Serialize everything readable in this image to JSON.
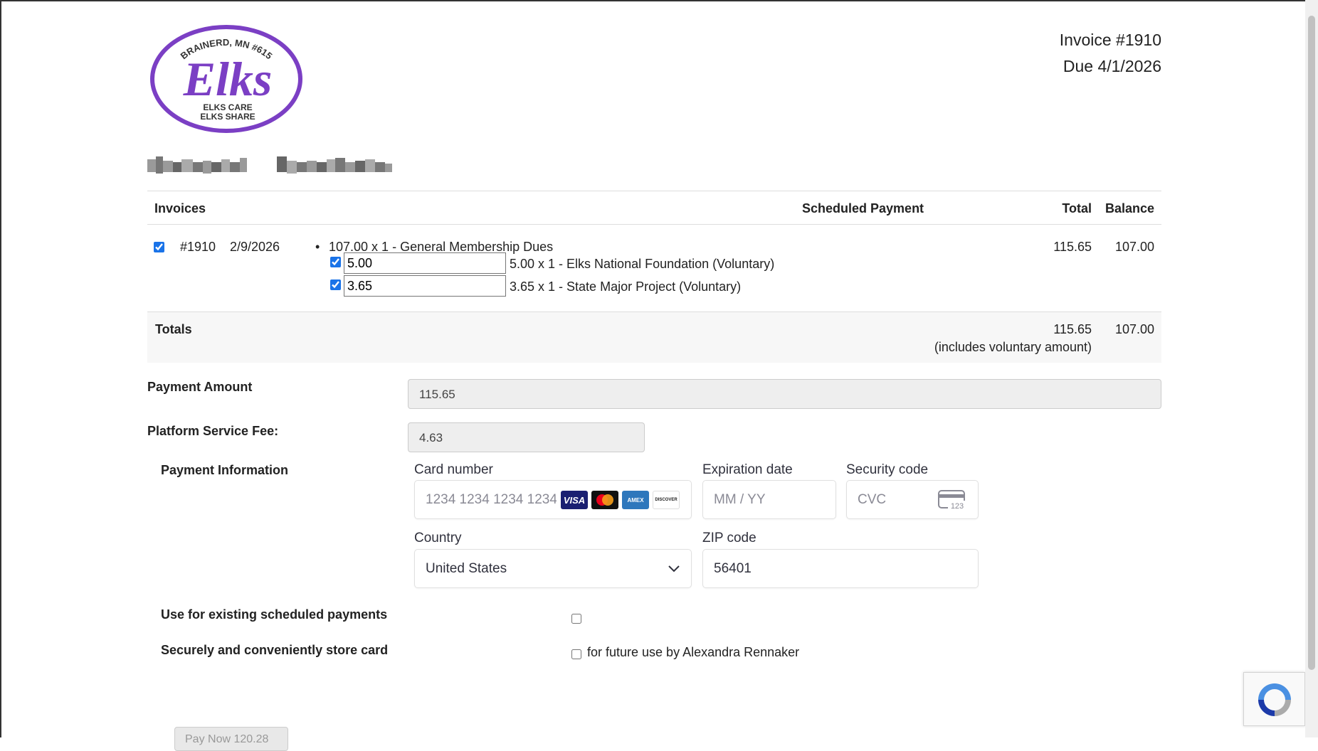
{
  "header": {
    "logo_text_top": "BRAINERD, MN #615",
    "logo_text_main": "Elks",
    "logo_text_bottom1": "ELKS CARE",
    "logo_text_bottom2": "ELKS SHARE",
    "invoice_number": "Invoice #1910",
    "due_date": "Due 4/1/2026"
  },
  "table": {
    "headers": {
      "invoices": "Invoices",
      "scheduled_payment": "Scheduled Payment",
      "total": "Total",
      "balance": "Balance"
    },
    "invoice": {
      "number": "#1910",
      "date": "2/9/2026",
      "main_line": "107.00 x 1 - General Membership Dues",
      "voluntary": [
        {
          "amount": "5.00",
          "text": "5.00 x 1 - Elks National Foundation (Voluntary)"
        },
        {
          "amount": "3.65",
          "text": "3.65 x 1 - State Major Project (Voluntary)"
        }
      ],
      "total": "115.65",
      "balance": "107.00"
    },
    "totals": {
      "label": "Totals",
      "total": "115.65",
      "note": "(includes voluntary amount)",
      "balance": "107.00"
    }
  },
  "payment": {
    "amount_label": "Payment Amount",
    "amount_value": "115.65",
    "fee_label": "Platform Service Fee:",
    "fee_value": "4.63",
    "info_label": "Payment Information",
    "card_number_label": "Card number",
    "card_number_placeholder": "1234 1234 1234 1234",
    "expiration_label": "Expiration date",
    "expiration_placeholder": "MM / YY",
    "security_label": "Security code",
    "security_placeholder": "CVC",
    "cvc_icon_text": "123",
    "country_label": "Country",
    "country_value": "United States",
    "zip_label": "ZIP code",
    "zip_value": "56401",
    "brands": [
      "VISA",
      "",
      "AMEX",
      "DISCOVER"
    ],
    "existing_label": "Use for existing scheduled payments",
    "store_label": "Securely and conveniently store card",
    "store_option": "for future use by Alexandra Rennaker",
    "pay_button": "Pay Now 120.28"
  },
  "colors": {
    "logo_purple": "#7b3fc4",
    "visa_blue": "#1a1f71",
    "amex_blue": "#2e77bc",
    "checkbox_blue": "#1a73e8"
  }
}
